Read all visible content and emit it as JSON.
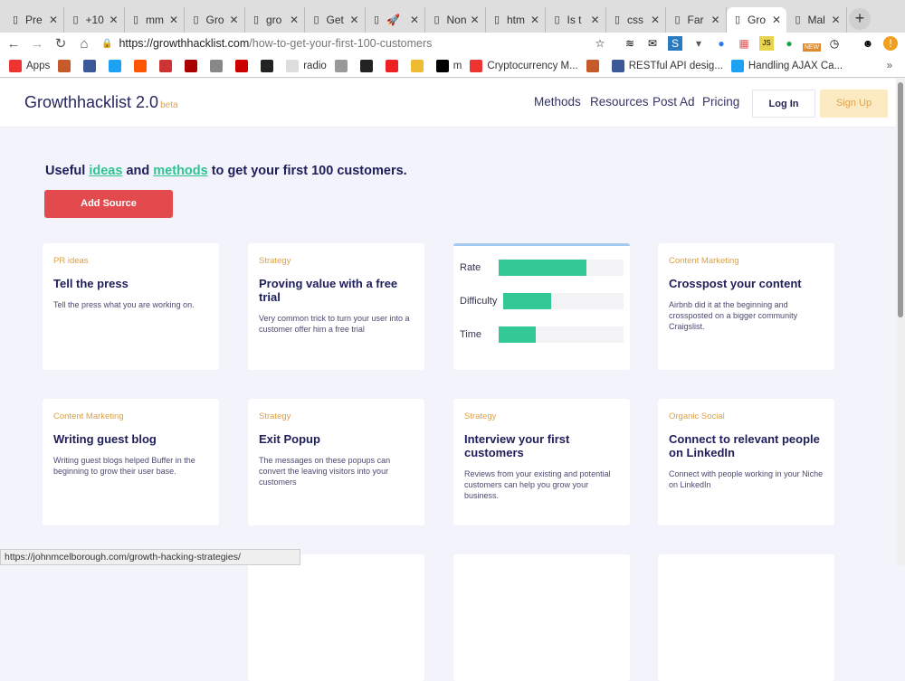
{
  "browser": {
    "tabs": [
      {
        "icon": "page-icon",
        "label": "Pre"
      },
      {
        "icon": "drop-icon",
        "label": "+10"
      },
      {
        "icon": "github-icon",
        "label": "mm"
      },
      {
        "icon": "page-icon",
        "label": "Gro"
      },
      {
        "icon": "grammarly-icon",
        "label": "gro"
      },
      {
        "icon": "page-icon",
        "label": "Get"
      },
      {
        "icon": "trello-icon",
        "label": "🚀"
      },
      {
        "icon": "red-circle-icon",
        "label": "Non"
      },
      {
        "icon": "stackoverflow-icon",
        "label": "htm"
      },
      {
        "icon": "stackoverflow-icon",
        "label": "Is t"
      },
      {
        "icon": "stackoverflow-icon",
        "label": "css"
      },
      {
        "icon": "page-icon",
        "label": "Far"
      },
      {
        "icon": "page-icon",
        "label": "Gro",
        "active": true
      },
      {
        "icon": "check-icon",
        "label": "Mal"
      }
    ],
    "url_host": "https://growthhacklist.com",
    "url_path": "/how-to-get-your-first-100-customers",
    "bookmarks": [
      "Apps",
      "",
      "",
      "",
      "",
      "",
      "",
      "",
      "",
      "",
      "radio",
      "",
      "",
      "",
      "",
      "m",
      "Cryptocurrency M...",
      "",
      "RESTful API desig...",
      "Handling AJAX Ca..."
    ],
    "new_badge": "NEW",
    "status_url": "https://johnmcelborough.com/growth-hacking-strategies/"
  },
  "header": {
    "logo": "Growthhacklist 2.0",
    "beta": "beta",
    "nav": [
      "Methods",
      "Resources",
      "Post Ad",
      "Pricing"
    ],
    "login": "Log In",
    "signup": "Sign Up"
  },
  "hero": {
    "pre": "Useful ",
    "ideas": "ideas",
    "mid": " and ",
    "methods": "methods",
    "post": " to get your first 100 customers.",
    "button": "Add Source"
  },
  "cards": [
    {
      "category": "PR ideas",
      "title": "Tell the press",
      "desc": "Tell the press what you are working on."
    },
    {
      "category": "Strategy",
      "title": "Proving value with a free trial",
      "desc": "Very common trick to turn your user into a customer offer him a free trial"
    },
    {
      "category": "Content Marketing",
      "title": "Crosspost your content",
      "desc": "Airbnb did it at the beginning and crossposted on a bigger community Craigslist."
    },
    {
      "category": "Content Marketing",
      "title": "Writing guest blog",
      "desc": "Writing guest blogs helped Buffer in the beginning to grow their user base."
    },
    {
      "category": "Strategy",
      "title": "Exit Popup",
      "desc": "The messages on these popups can convert the leaving visitors into your customers"
    },
    {
      "category": "Strategy",
      "title": "Interview your first customers",
      "desc": "Reviews from your existing and potential customers can help you grow your business."
    },
    {
      "category": "Organic Social",
      "title": "Connect to relevant people on LinkedIn",
      "desc": "Connect with people working in your Niche on LinkedIn"
    }
  ],
  "stats": [
    {
      "label": "Rate",
      "value": 0.7
    },
    {
      "label": "Difficulty",
      "value": 0.4
    },
    {
      "label": "Time",
      "value": 0.3
    }
  ],
  "colors": {
    "accent": "#32c996",
    "cta": "#e24a4d",
    "category": "#d9a04a",
    "title": "#1e1e5a"
  }
}
